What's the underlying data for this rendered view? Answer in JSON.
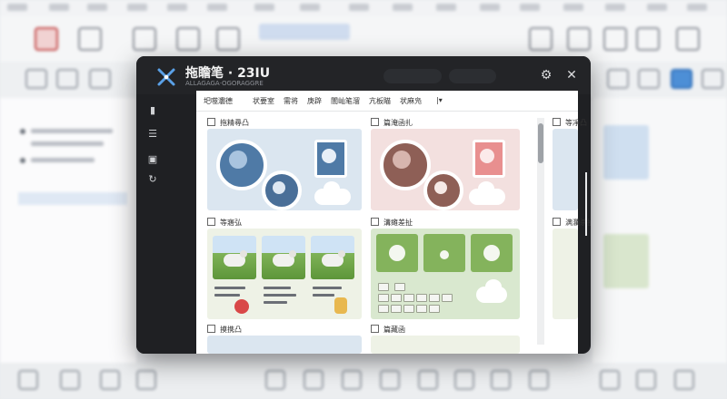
{
  "window": {
    "title": "拖瞻笔 · 23IU",
    "subtitle": "ALLAGAGA·OGORAGGRE",
    "settings_icon": "gear-icon",
    "close_icon": "close-icon"
  },
  "menu": [
    "圯噬灞德",
    "状要室",
    "需将",
    "庚辟",
    "闇屾笔溜",
    "亢板瞄",
    "状麻凫"
  ],
  "sections": [
    {
      "title": "拖精尋凸",
      "theme": "#4d6f96"
    },
    {
      "title": "篇淹函扎",
      "theme": "#8d6a60"
    },
    {
      "title": "等寤弘",
      "theme": "#6b9a45"
    },
    {
      "title": "溝瘫差扯",
      "theme": "#6fa04f"
    },
    {
      "title": "摸携凸",
      "theme": "#777777"
    },
    {
      "title": "篇藏函",
      "theme": "#777777"
    }
  ],
  "side_header": "等凈凸",
  "side_header2": "满瀾杀扯",
  "rail_icons": [
    "document-icon",
    "layers-icon",
    "image-icon",
    "refresh-icon"
  ]
}
